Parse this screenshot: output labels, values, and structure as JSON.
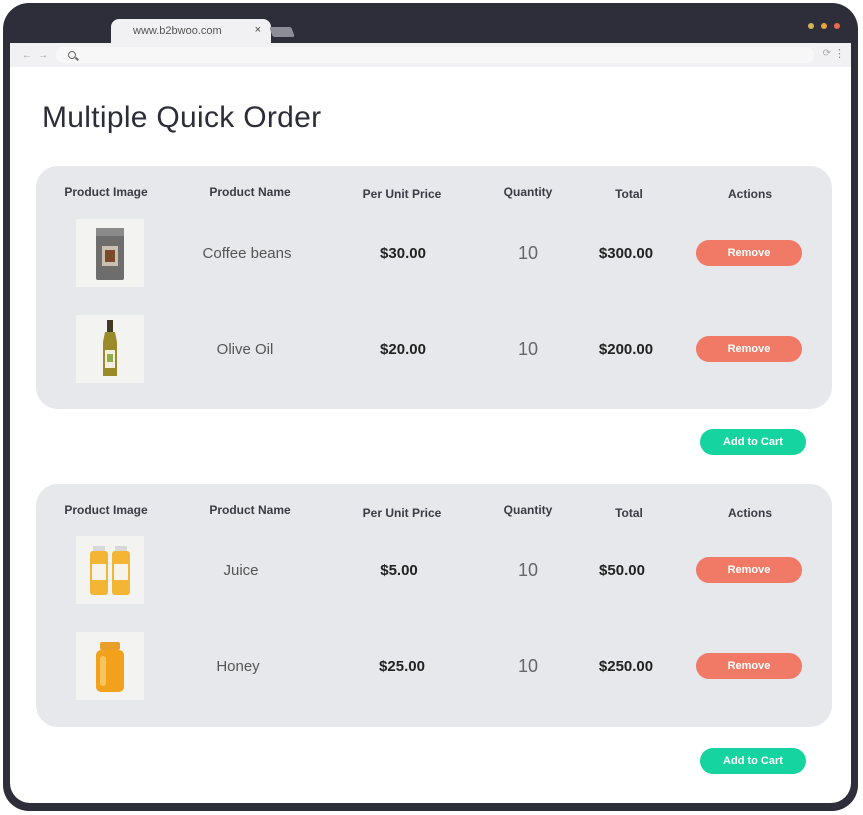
{
  "browser": {
    "tab_title": "www.b2bwoo.com",
    "tab_close": "×",
    "window_dots": [
      "#d1b35a",
      "#e9a33a",
      "#e86a4d"
    ]
  },
  "page": {
    "title": "Multiple Quick Order"
  },
  "headers": {
    "image": "Product Image",
    "name": "Product Name",
    "price": "Per Unit Price",
    "quantity": "Quantity",
    "total": "Total",
    "actions": "Actions"
  },
  "orders": [
    {
      "items": [
        {
          "name": "Coffee beans",
          "price": "$30.00",
          "quantity": "10",
          "total": "$300.00",
          "action": "Remove",
          "image": "coffee-bag-icon"
        },
        {
          "name": "Olive Oil",
          "price": "$20.00",
          "quantity": "10",
          "total": "$200.00",
          "action": "Remove",
          "image": "olive-oil-bottle-icon"
        }
      ],
      "cart_label": "Add to Cart"
    },
    {
      "items": [
        {
          "name": "Juice",
          "price": "$5.00",
          "quantity": "10",
          "total": "$50.00",
          "action": "Remove",
          "image": "juice-bottles-icon"
        },
        {
          "name": "Honey",
          "price": "$25.00",
          "quantity": "10",
          "total": "$250.00",
          "action": "Remove",
          "image": "honey-jar-icon"
        }
      ],
      "cart_label": "Add to Cart"
    }
  ],
  "colors": {
    "remove": "#f07a66",
    "add_to_cart": "#16d4a0",
    "card": "#e7e8ec",
    "frame": "#2e2e3a"
  }
}
